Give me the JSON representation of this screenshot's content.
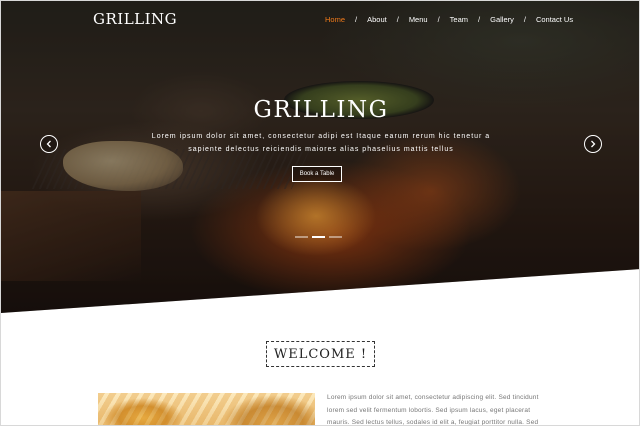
{
  "brand": {
    "logo": "GRILLING"
  },
  "nav": {
    "items": [
      "Home",
      "About",
      "Menu",
      "Team",
      "Gallery",
      "Contact Us"
    ],
    "active": "Home",
    "separator": "/"
  },
  "hero": {
    "title": "GRILLING",
    "text_line1": "Lorem ipsum dolor sit amet, consectetur adipi est Itaque earum rerum hic tenetur a",
    "text_line2": "sapiente delectus reiciendis maiores alias phaselius mattis tellus",
    "button_label": "Book a Table",
    "prev_icon": "chevron-left-icon",
    "next_icon": "chevron-right-icon",
    "slide_count": 3,
    "active_slide": 2
  },
  "welcome": {
    "heading": "WELCOME !"
  },
  "about": {
    "line1": "Lorem ipsum dolor sit amet, consectetur adipiscing elit. Sed tincidunt",
    "line2": "lorem sed velit fermentum lobortis. Sed ipsum lacus, eget placerat",
    "line3": "mauris. Sed lectus tellus, sodales id elit a, feugiat porttitor nulla. Sed"
  },
  "colors": {
    "accent": "#f07a1a",
    "text_dark": "#222222",
    "text_muted": "#777777"
  }
}
